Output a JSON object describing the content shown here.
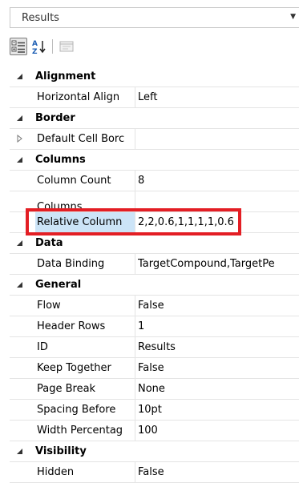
{
  "object_selector": {
    "value": "Results"
  },
  "toolbar": {
    "categorized_icon": "categorized-grid-icon",
    "alphabetical_icon": "sort-az-icon",
    "property_pages_icon": "property-pages-icon"
  },
  "colors": {
    "highlight": "#e31e24",
    "selected_row": "#cce4f7"
  },
  "groups": {
    "alignment": {
      "label": "Alignment",
      "expanded": true,
      "props": [
        {
          "name": "Horizontal Align",
          "value": "Left"
        }
      ]
    },
    "border": {
      "label": "Border",
      "expanded": true,
      "props": [
        {
          "name": "Default Cell Borc",
          "value": "",
          "expandable": true
        }
      ]
    },
    "columns": {
      "label": "Columns",
      "expanded": true,
      "props": [
        {
          "name": "Column Count",
          "value": "8"
        },
        {
          "name": "Columns",
          "value": ""
        },
        {
          "name": "Relative Column",
          "value": "2,2,0.6,1,1,1,1,0.6",
          "selected": true
        }
      ]
    },
    "data": {
      "label": "Data",
      "expanded": true,
      "props": [
        {
          "name": "Data Binding",
          "value": "TargetCompound,TargetPe"
        }
      ]
    },
    "general": {
      "label": "General",
      "expanded": true,
      "props": [
        {
          "name": "Flow",
          "value": "False"
        },
        {
          "name": "Header Rows",
          "value": "1"
        },
        {
          "name": "ID",
          "value": "Results"
        },
        {
          "name": "Keep Together",
          "value": "False"
        },
        {
          "name": "Page Break",
          "value": "None"
        },
        {
          "name": "Spacing Before",
          "value": "10pt"
        },
        {
          "name": "Width Percentag",
          "value": "100"
        }
      ]
    },
    "visibility": {
      "label": "Visibility",
      "expanded": true,
      "props": [
        {
          "name": "Hidden",
          "value": "False"
        }
      ]
    }
  }
}
